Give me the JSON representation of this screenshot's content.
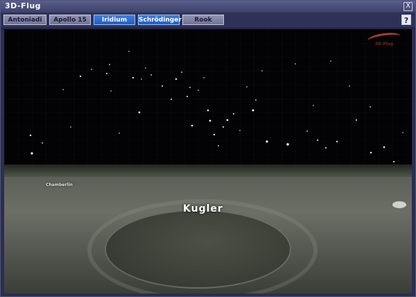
{
  "window": {
    "title": "3D-Flug",
    "close_label": "X",
    "help_label": "?"
  },
  "tabs": [
    {
      "label": "Antoniadi",
      "active": false
    },
    {
      "label": "Apollo 15",
      "active": false
    },
    {
      "label": "Iridium",
      "active": false
    },
    {
      "label": "Schrödinger",
      "active": true
    },
    {
      "label": "Rook",
      "active": false
    }
  ],
  "scene": {
    "main_label": "Kugler",
    "secondary_label": "Chamberlin",
    "logo_text": "3D-Flug"
  },
  "colors": {
    "accent": "#1f5ec8",
    "titlebar": "#3c416a",
    "window_bg": "#2b2e50"
  }
}
